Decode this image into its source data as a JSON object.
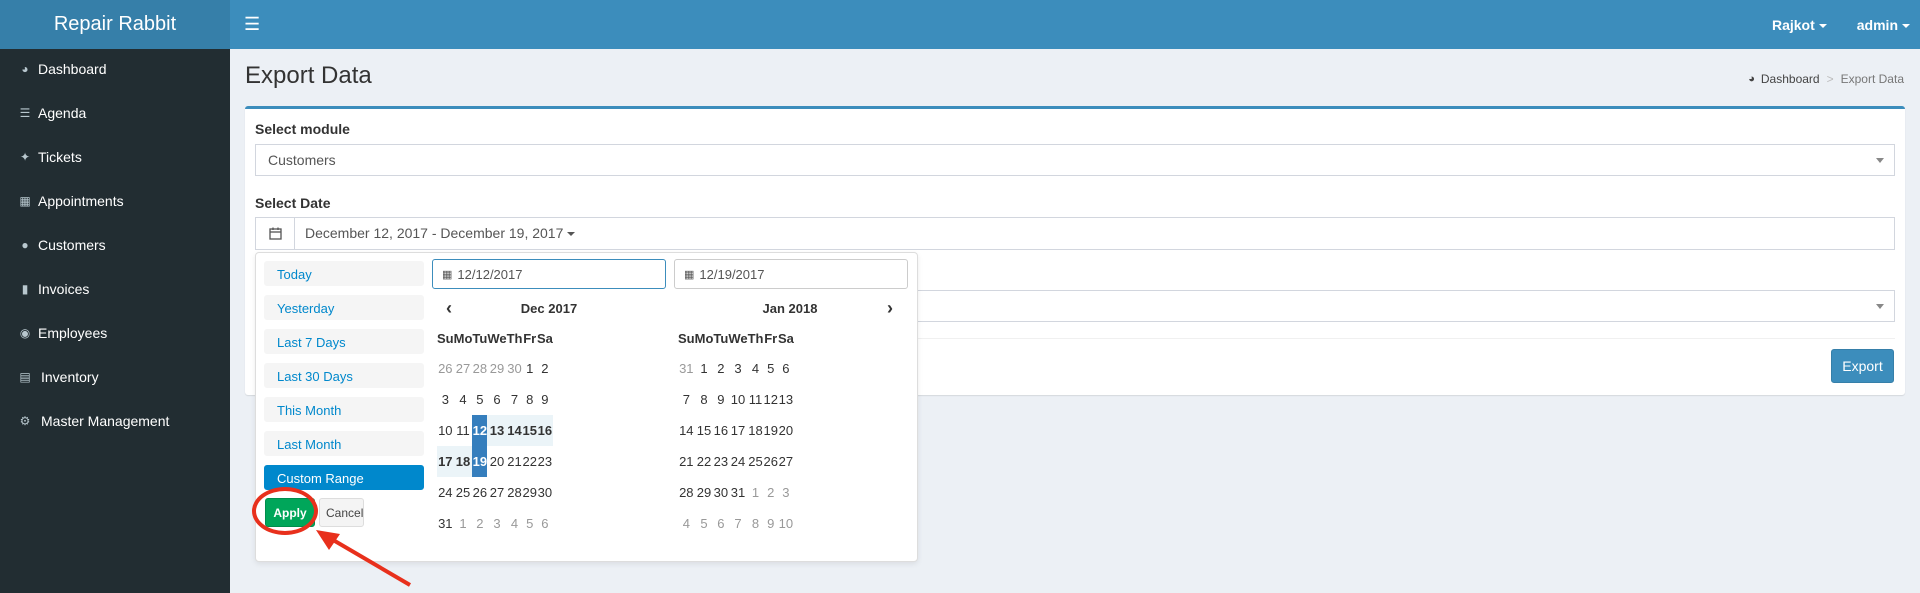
{
  "app": {
    "title": "Repair Rabbit"
  },
  "topnav": {
    "location": "Rajkot",
    "user": "admin"
  },
  "sidebar": {
    "items": [
      {
        "label": "Dashboard",
        "icon": "dashboard-icon"
      },
      {
        "label": "Agenda",
        "icon": "list-icon"
      },
      {
        "label": "Tickets",
        "icon": "ticket-icon"
      },
      {
        "label": "Appointments",
        "icon": "calendar-plus-icon"
      },
      {
        "label": "Customers",
        "icon": "users-icon"
      },
      {
        "label": "Invoices",
        "icon": "file-icon"
      },
      {
        "label": "Employees",
        "icon": "user-circle-icon"
      },
      {
        "label": "Inventory",
        "icon": "list-alt-icon"
      },
      {
        "label": "Master Management",
        "icon": "cogs-icon"
      }
    ]
  },
  "page": {
    "title": "Export Data",
    "breadcrumb": {
      "home": "Dashboard",
      "separator": ">",
      "current": "Export Data"
    }
  },
  "form": {
    "module_label": "Select module",
    "module_value": "Customers",
    "date_label": "Select Date",
    "date_value": "December 12, 2017 - December 19, 2017",
    "export_label": "Export"
  },
  "picker": {
    "ranges": [
      "Today",
      "Yesterday",
      "Last 7 Days",
      "Last 30 Days",
      "This Month",
      "Last Month",
      "Custom Range"
    ],
    "active_range": "Custom Range",
    "apply_label": "Apply",
    "cancel_label": "Cancel",
    "start_input": "12/12/2017",
    "end_input": "12/19/2017",
    "weekdays": [
      "Su",
      "Mo",
      "Tu",
      "We",
      "Th",
      "Fr",
      "Sa"
    ],
    "left": {
      "month": "Dec 2017",
      "weeks": [
        [
          "26",
          "27",
          "28",
          "29",
          "30",
          "1",
          "2"
        ],
        [
          "3",
          "4",
          "5",
          "6",
          "7",
          "8",
          "9"
        ],
        [
          "10",
          "11",
          "12",
          "13",
          "14",
          "15",
          "16"
        ],
        [
          "17",
          "18",
          "19",
          "20",
          "21",
          "22",
          "23"
        ],
        [
          "24",
          "25",
          "26",
          "27",
          "28",
          "29",
          "30"
        ],
        [
          "31",
          "1",
          "2",
          "3",
          "4",
          "5",
          "6"
        ]
      ]
    },
    "right": {
      "month": "Jan 2018",
      "weeks": [
        [
          "31",
          "1",
          "2",
          "3",
          "4",
          "5",
          "6"
        ],
        [
          "7",
          "8",
          "9",
          "10",
          "11",
          "12",
          "13"
        ],
        [
          "14",
          "15",
          "16",
          "17",
          "18",
          "19",
          "20"
        ],
        [
          "21",
          "22",
          "23",
          "24",
          "25",
          "26",
          "27"
        ],
        [
          "28",
          "29",
          "30",
          "31",
          "1",
          "2",
          "3"
        ],
        [
          "4",
          "5",
          "6",
          "7",
          "8",
          "9",
          "10"
        ]
      ]
    }
  },
  "colors": {
    "header": "#3c8dbc",
    "sidebar": "#222d32",
    "apply": "#00a65a",
    "selected": "#357ebd",
    "annotation": "#e8301c"
  }
}
